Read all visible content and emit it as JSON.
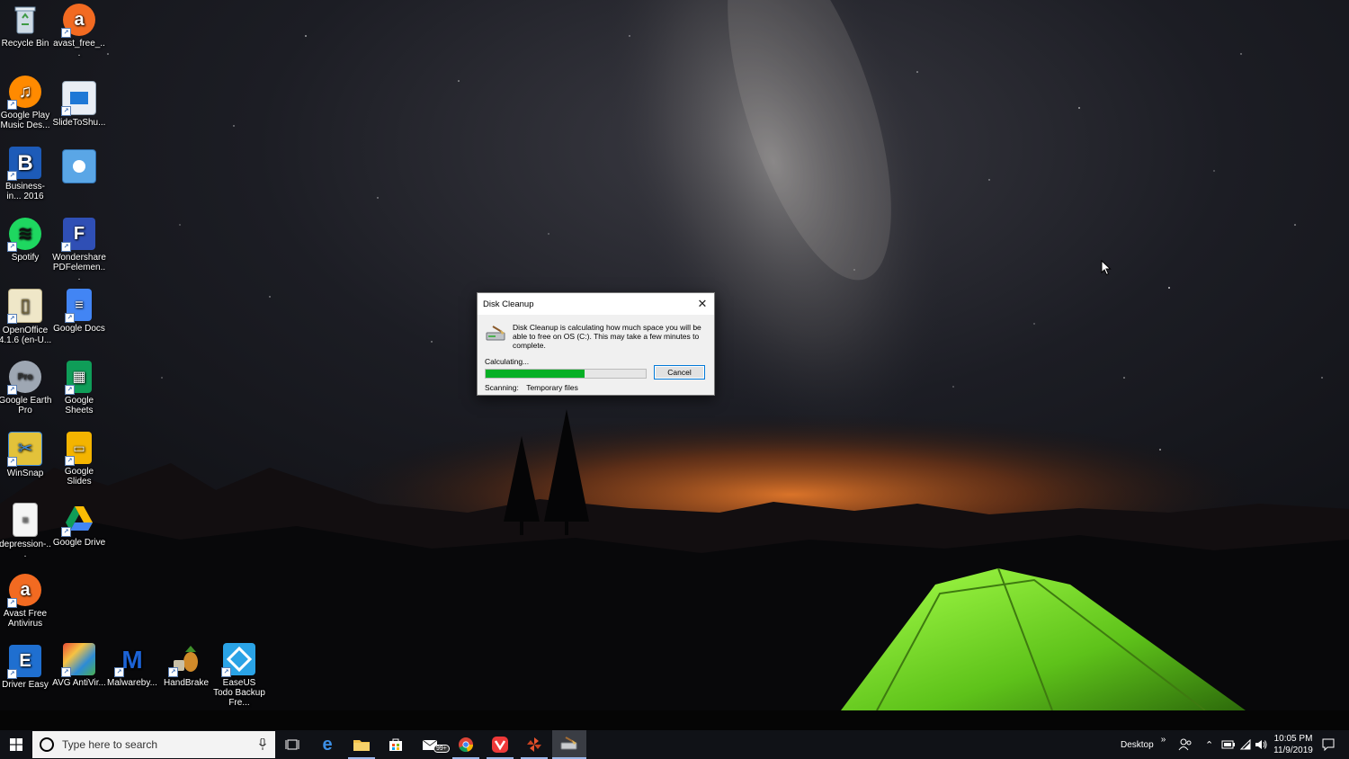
{
  "desktop": {
    "icons": [
      {
        "label": "Recycle Bin",
        "icon": "recycle-bin-icon",
        "color": "#9fb3c8"
      },
      {
        "label": "avast_free_...",
        "icon": "avast-icon",
        "color": "#f26a21"
      },
      {
        "label": "Google Play Music Des...",
        "icon": "google-play-music-icon",
        "color": "#ff7a00"
      },
      {
        "label": "SlideToShu...",
        "icon": "slidetoshutdown-icon",
        "color": "#1e78d6"
      },
      {
        "label": "Business-in... 2016",
        "icon": "business-in-icon",
        "color": "#1d5bb8"
      },
      {
        "label": "",
        "icon": "control-panel-icon",
        "color": "#5aa6e6"
      },
      {
        "label": "Spotify",
        "icon": "spotify-icon",
        "color": "#1ed760"
      },
      {
        "label": "Wondershare PDFelemen...",
        "icon": "pdfelement-icon",
        "color": "#2f4fb5"
      },
      {
        "label": "OpenOffice 4.1.6 (en-U...",
        "icon": "openoffice-icon",
        "color": "#e8e1c4"
      },
      {
        "label": "Google Docs",
        "icon": "google-docs-icon",
        "color": "#4285f4"
      },
      {
        "label": "Google Earth Pro",
        "icon": "google-earth-icon",
        "color": "#9ea7b3"
      },
      {
        "label": "Google Sheets",
        "icon": "google-sheets-icon",
        "color": "#0f9d58"
      },
      {
        "label": "WinSnap",
        "icon": "winsnap-icon",
        "color": "#3b88d8"
      },
      {
        "label": "Google Slides",
        "icon": "google-slides-icon",
        "color": "#f4b400"
      },
      {
        "label": "depression-...",
        "icon": "document-icon",
        "color": "#f5f5f5"
      },
      {
        "label": "Google Drive",
        "icon": "google-drive-icon",
        "color": "#fbbc04"
      },
      {
        "label": "Avast Free Antivirus",
        "icon": "avast-antivirus-icon",
        "color": "#f26a21"
      },
      {
        "label": "Driver Easy",
        "icon": "driver-easy-icon",
        "color": "#1f6fd0"
      },
      {
        "label": "AVG AntiVir...",
        "icon": "avg-icon",
        "color": "#e84b35"
      },
      {
        "label": "Malwareby...",
        "icon": "malwarebytes-icon",
        "color": "#1c63d6"
      },
      {
        "label": "HandBrake",
        "icon": "handbrake-icon",
        "color": "#c9752a"
      },
      {
        "label": "EaseUS Todo Backup Fre...",
        "icon": "easeus-icon",
        "color": "#2aa3e6"
      }
    ]
  },
  "dialog": {
    "title": "Disk Cleanup",
    "message": "Disk Cleanup is calculating how much space you will be able to free on OS (C:). This may take a few minutes to complete.",
    "status": "Calculating...",
    "progress": 0.62,
    "cancel_label": "Cancel",
    "scanning_label": "Scanning:",
    "scanning_item": "Temporary files"
  },
  "taskbar": {
    "search_placeholder": "Type here to search",
    "mail_badge": "99+",
    "toolbar_label": "Desktop",
    "toolbar_chevron": "»",
    "time": "10:05 PM",
    "date": "11/9/2019",
    "accent": "#9ab6e8"
  }
}
